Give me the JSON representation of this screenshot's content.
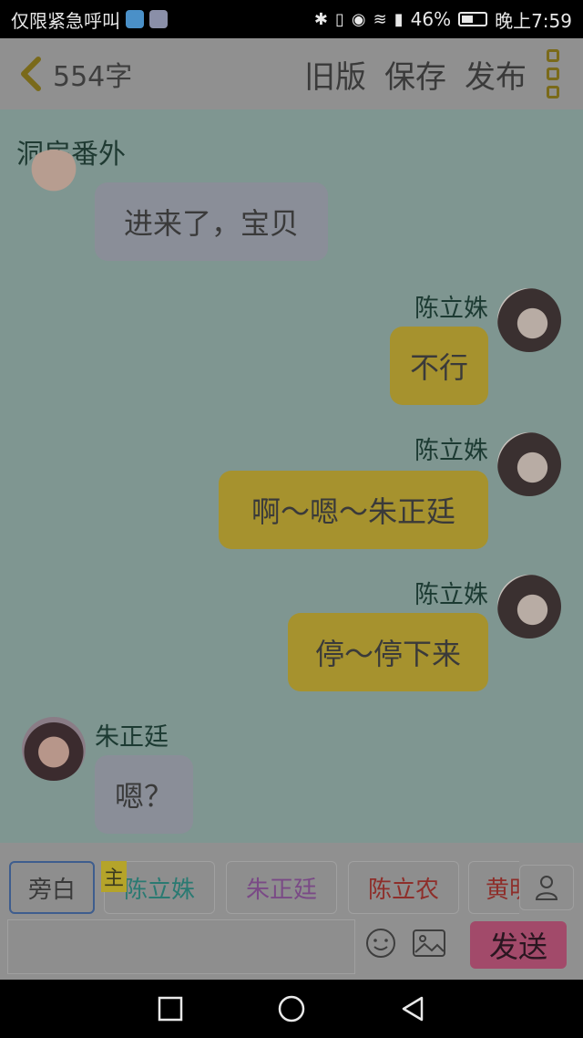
{
  "status_bar": {
    "carrier_text": "仅限紧急呼叫",
    "battery": "46%",
    "time": "晚上7:59"
  },
  "header": {
    "word_count": "554字",
    "actions": [
      "旧版",
      "保存",
      "发布"
    ]
  },
  "chat": {
    "title": "洞房番外",
    "messages": [
      {
        "speaker": "",
        "text": "进来了，宝贝",
        "side": "left"
      },
      {
        "speaker": "陈立姝",
        "text": "不行",
        "side": "right"
      },
      {
        "speaker": "陈立姝",
        "text": "啊～嗯～朱正廷",
        "side": "right"
      },
      {
        "speaker": "陈立姝",
        "text": "停～停下来",
        "side": "right"
      },
      {
        "speaker": "朱正廷",
        "text": "嗯？",
        "side": "left"
      }
    ]
  },
  "input_panel": {
    "characters": [
      {
        "label": "旁白",
        "color": "#3a3a3a"
      },
      {
        "label": "陈立姝",
        "color": "#2a7a72"
      },
      {
        "label": "朱正廷",
        "color": "#7a4a86"
      },
      {
        "label": "陈立农",
        "color": "#8e2e2a"
      },
      {
        "label": "黄明",
        "color": "#8e2e2a"
      }
    ],
    "main_tag": "主",
    "send_label": "发送"
  },
  "colors": {
    "bubble_self": "#a6922e",
    "bubble_other": "#8a8e98",
    "send_button": "#a24a6a"
  }
}
